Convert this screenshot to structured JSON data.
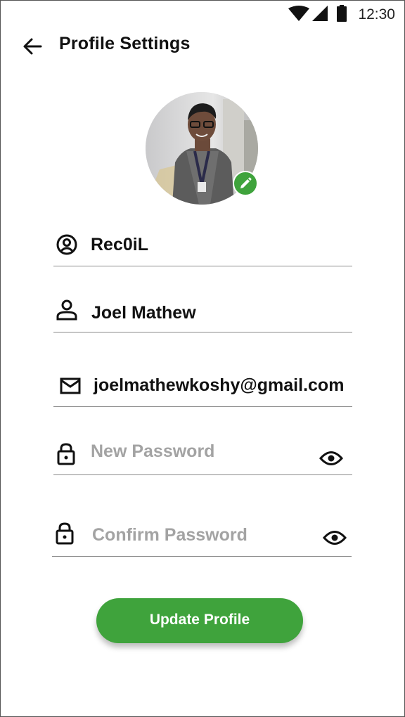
{
  "status_bar": {
    "time": "12:30"
  },
  "header": {
    "title": "Profile Settings"
  },
  "profile": {
    "username": "Rec0iL",
    "full_name": "Joel Mathew",
    "email": "joelmathewkoshy@gmail.com"
  },
  "password": {
    "new_placeholder": "New Password",
    "confirm_placeholder": "Confirm Password"
  },
  "actions": {
    "update_label": "Update Profile"
  },
  "colors": {
    "accent": "#3fa33c"
  },
  "icons": [
    "arrow-back-icon",
    "pencil-icon",
    "account-circle-icon",
    "person-icon",
    "mail-icon",
    "lock-icon",
    "eye-icon"
  ]
}
